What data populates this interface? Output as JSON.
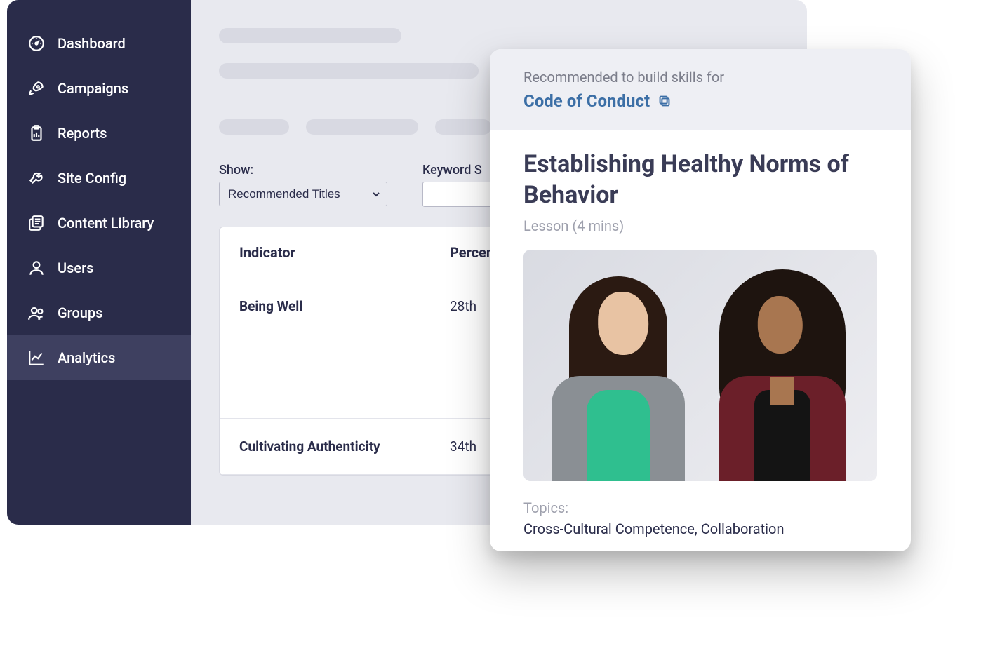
{
  "sidebar": {
    "items": [
      {
        "label": "Dashboard"
      },
      {
        "label": "Campaigns"
      },
      {
        "label": "Reports"
      },
      {
        "label": "Site Config"
      },
      {
        "label": "Content Library"
      },
      {
        "label": "Users"
      },
      {
        "label": "Groups"
      },
      {
        "label": "Analytics"
      }
    ]
  },
  "filters": {
    "show_label": "Show:",
    "show_value": "Recommended Titles",
    "keyword_label": "Keyword S",
    "keyword_value": ""
  },
  "table": {
    "headers": {
      "indicator": "Indicator",
      "percent": "Percent"
    },
    "rows": [
      {
        "indicator": "Being Well",
        "percent": "28th"
      },
      {
        "indicator": "Cultivating Authenticity",
        "percent": "34th"
      }
    ]
  },
  "card": {
    "recommended_text": "Recommended to build skills for",
    "link_text": "Code of Conduct",
    "title": "Establishing Healthy Norms of Behavior",
    "meta": "Lesson (4 mins)",
    "topics_label": "Topics:",
    "topics_value": "Cross-Cultural Competence, Collaboration"
  }
}
